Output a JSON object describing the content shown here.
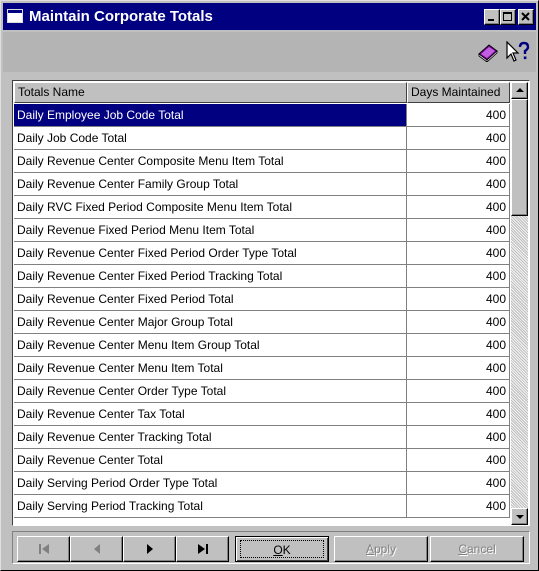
{
  "window": {
    "title": "Maintain Corporate Totals",
    "controls": {
      "minimize": "_",
      "maximize": "□",
      "close": "✕"
    }
  },
  "toolbar": {
    "items": [
      {
        "icon": "book-icon",
        "interactable": true
      },
      {
        "icon": "whats-this-help-icon",
        "interactable": true
      }
    ]
  },
  "grid": {
    "columns": [
      "Totals Name",
      "Days Maintained"
    ],
    "selected_row": 0,
    "rows": [
      {
        "name": "Daily Employee Job Code Total",
        "days": "400"
      },
      {
        "name": "Daily Job Code Total",
        "days": "400"
      },
      {
        "name": "Daily Revenue Center Composite Menu Item Total",
        "days": "400"
      },
      {
        "name": "Daily Revenue Center Family Group Total",
        "days": "400"
      },
      {
        "name": "Daily RVC Fixed Period Composite Menu Item Total",
        "days": "400"
      },
      {
        "name": "Daily Revenue Fixed Period Menu Item Total",
        "days": "400"
      },
      {
        "name": "Daily Revenue Center Fixed Period Order Type Total",
        "days": "400"
      },
      {
        "name": "Daily Revenue Center Fixed Period Tracking Total",
        "days": "400"
      },
      {
        "name": "Daily Revenue Center Fixed Period Total",
        "days": "400"
      },
      {
        "name": "Daily Revenue Center Major Group Total",
        "days": "400"
      },
      {
        "name": "Daily Revenue Center Menu Item Group Total",
        "days": "400"
      },
      {
        "name": "Daily Revenue Center Menu Item Total",
        "days": "400"
      },
      {
        "name": "Daily Revenue Center Order Type Total",
        "days": "400"
      },
      {
        "name": "Daily Revenue Center Tax Total",
        "days": "400"
      },
      {
        "name": "Daily Revenue Center Tracking Total",
        "days": "400"
      },
      {
        "name": "Daily Revenue Center Total",
        "days": "400"
      },
      {
        "name": "Daily Serving Period Order Type Total",
        "days": "400"
      },
      {
        "name": "Daily Serving Period Tracking Total",
        "days": "400"
      }
    ]
  },
  "buttons": {
    "first_icon": "first-record-icon",
    "prev_icon": "previous-record-icon",
    "next_icon": "next-record-icon",
    "last_icon": "last-record-icon",
    "ok": {
      "mnemonic": "O",
      "rest": "K"
    },
    "apply": {
      "mnemonic": "A",
      "rest": "pply",
      "enabled": false
    },
    "cancel": {
      "mnemonic": "C",
      "rest": "ancel",
      "enabled": false
    }
  },
  "colors": {
    "titlebar": "#000080",
    "selection": "#000080",
    "face": "#c0c0c0"
  }
}
